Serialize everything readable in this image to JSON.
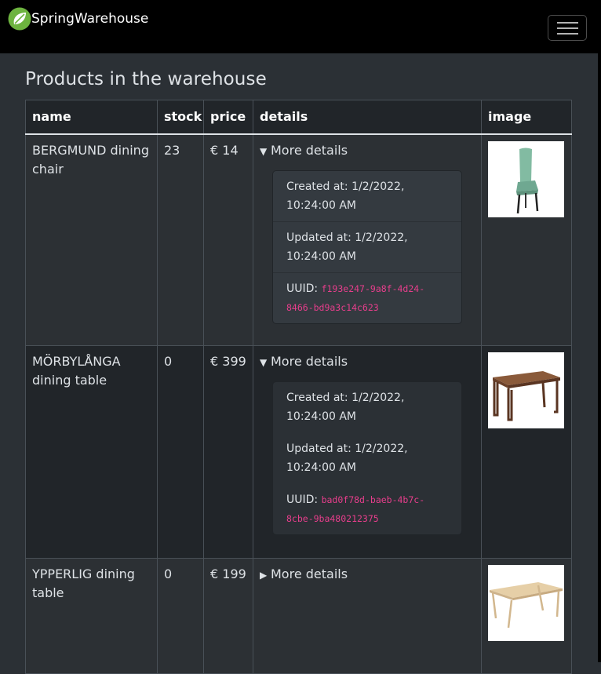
{
  "navbar": {
    "brand": "SpringWarehouse",
    "logo_icon": "spring-leaf-icon",
    "toggle_icon": "hamburger-icon"
  },
  "page": {
    "title": "Products in the warehouse"
  },
  "table": {
    "headers": {
      "name": "name",
      "stock": "stock",
      "price": "price",
      "details": "details",
      "image": "image"
    },
    "rows": [
      {
        "name": "BERGMUND dining chair",
        "stock": "23",
        "price": "€ 14",
        "details_summary": "More details",
        "expanded": true,
        "created": "Created at: 1/2/2022, 10:24:00 AM",
        "updated": "Updated at: 1/2/2022, 10:24:00 AM",
        "uuid_label": "UUID: ",
        "uuid": "f193e247-9a8f-4d24-8466-bd9a3c14c623",
        "image_icon": "chair-icon"
      },
      {
        "name": "MÖRBYLÅNGA dining table",
        "stock": "0",
        "price": "€ 399",
        "details_summary": "More details",
        "expanded": true,
        "created": "Created at: 1/2/2022, 10:24:00 AM",
        "updated": "Updated at: 1/2/2022, 10:24:00 AM",
        "uuid_label": "UUID: ",
        "uuid": "bad0f78d-baeb-4b7c-8cbe-9ba480212375",
        "image_icon": "wooden-table-icon"
      },
      {
        "name": "YPPERLIG dining table",
        "stock": "0",
        "price": "€ 199",
        "details_summary": "More details",
        "expanded": false,
        "image_icon": "light-table-icon"
      }
    ]
  },
  "colors": {
    "navbar_bg": "#000000",
    "body_bg": "#2b3035",
    "uuid_text": "#e83e8c",
    "chair_fabric": "#7fb8a0"
  }
}
